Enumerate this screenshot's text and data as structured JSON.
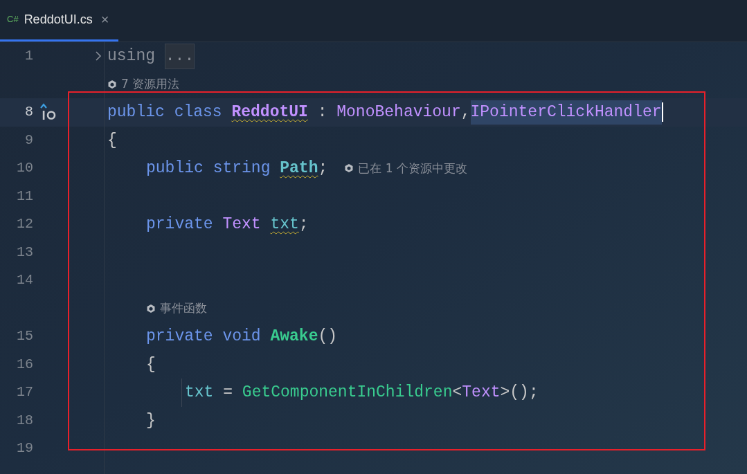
{
  "tab": {
    "language": "C#",
    "title": "ReddotUI.cs",
    "close": "×",
    "selected": true
  },
  "lines": [
    {
      "kind": "code",
      "number": "1",
      "folded": true,
      "tokens": [
        {
          "kind": "dim",
          "text": "using"
        },
        {
          "kind": "folded",
          "text": "...",
          "spaced": true
        }
      ]
    },
    {
      "kind": "hint",
      "text": "7 资源用法"
    },
    {
      "kind": "code",
      "number": "8",
      "current": true,
      "implements": true,
      "tokens": [
        {
          "kind": "keyword",
          "text": "public"
        },
        {
          "kind": "keyword",
          "text": "class",
          "spaced": true
        },
        {
          "kind": "type",
          "text": "ReddotUI",
          "bold": true,
          "warning": true,
          "spaced": true
        },
        {
          "kind": "plain",
          "text": ":",
          "spaced": true
        },
        {
          "kind": "type",
          "text": "MonoBehaviour",
          "spaced": true
        },
        {
          "kind": "plain",
          "text": ","
        },
        {
          "kind": "type",
          "text": "IPointerClickHandler",
          "selected": true,
          "caret": true
        }
      ]
    },
    {
      "kind": "code",
      "number": "9",
      "tokens": [
        {
          "kind": "plain",
          "text": "{"
        }
      ]
    },
    {
      "kind": "block",
      "children": [
        {
          "kind": "code",
          "number": "10",
          "hint": "已在 1 个资源中更改",
          "tokens": [
            {
              "kind": "keyword",
              "text": "public"
            },
            {
              "kind": "keyword",
              "text": "string",
              "spaced": true
            },
            {
              "kind": "field",
              "text": "Path",
              "bold": true,
              "warning": true,
              "spaced": true
            },
            {
              "kind": "plain",
              "text": ";"
            }
          ]
        },
        {
          "kind": "code",
          "number": "11"
        },
        {
          "kind": "code",
          "number": "12",
          "tokens": [
            {
              "kind": "keyword",
              "text": "private"
            },
            {
              "kind": "type",
              "text": "Text",
              "spaced": true
            },
            {
              "kind": "field",
              "text": "txt",
              "warning": true,
              "spaced": true
            },
            {
              "kind": "plain",
              "text": ";"
            }
          ]
        },
        {
          "kind": "code",
          "number": "13"
        },
        {
          "kind": "code",
          "number": "14"
        },
        {
          "kind": "hint",
          "text": "事件函数"
        },
        {
          "kind": "code",
          "number": "15",
          "tokens": [
            {
              "kind": "keyword",
              "text": "private"
            },
            {
              "kind": "keyword",
              "text": "void",
              "spaced": true
            },
            {
              "kind": "method",
              "text": "Awake",
              "bold": true,
              "spaced": true
            },
            {
              "kind": "plain",
              "text": "()"
            }
          ]
        },
        {
          "kind": "code",
          "number": "16",
          "tokens": [
            {
              "kind": "plain",
              "text": "{"
            }
          ]
        },
        {
          "kind": "block",
          "guide": true,
          "children": [
            {
              "kind": "code",
              "number": "17",
              "tokens": [
                {
                  "kind": "field",
                  "text": "txt"
                },
                {
                  "kind": "plain",
                  "text": "=",
                  "spaced": true
                },
                {
                  "kind": "method",
                  "text": "GetComponentInChildren",
                  "spaced": true
                },
                {
                  "kind": "plain",
                  "text": "<"
                },
                {
                  "kind": "type",
                  "text": "Text"
                },
                {
                  "kind": "plain",
                  "text": ">();"
                }
              ]
            }
          ]
        },
        {
          "kind": "code",
          "number": "18",
          "tokens": [
            {
              "kind": "plain",
              "text": "}"
            }
          ]
        }
      ]
    },
    {
      "kind": "code",
      "number": "19"
    }
  ],
  "annotation": {
    "color": "#e8202a"
  }
}
